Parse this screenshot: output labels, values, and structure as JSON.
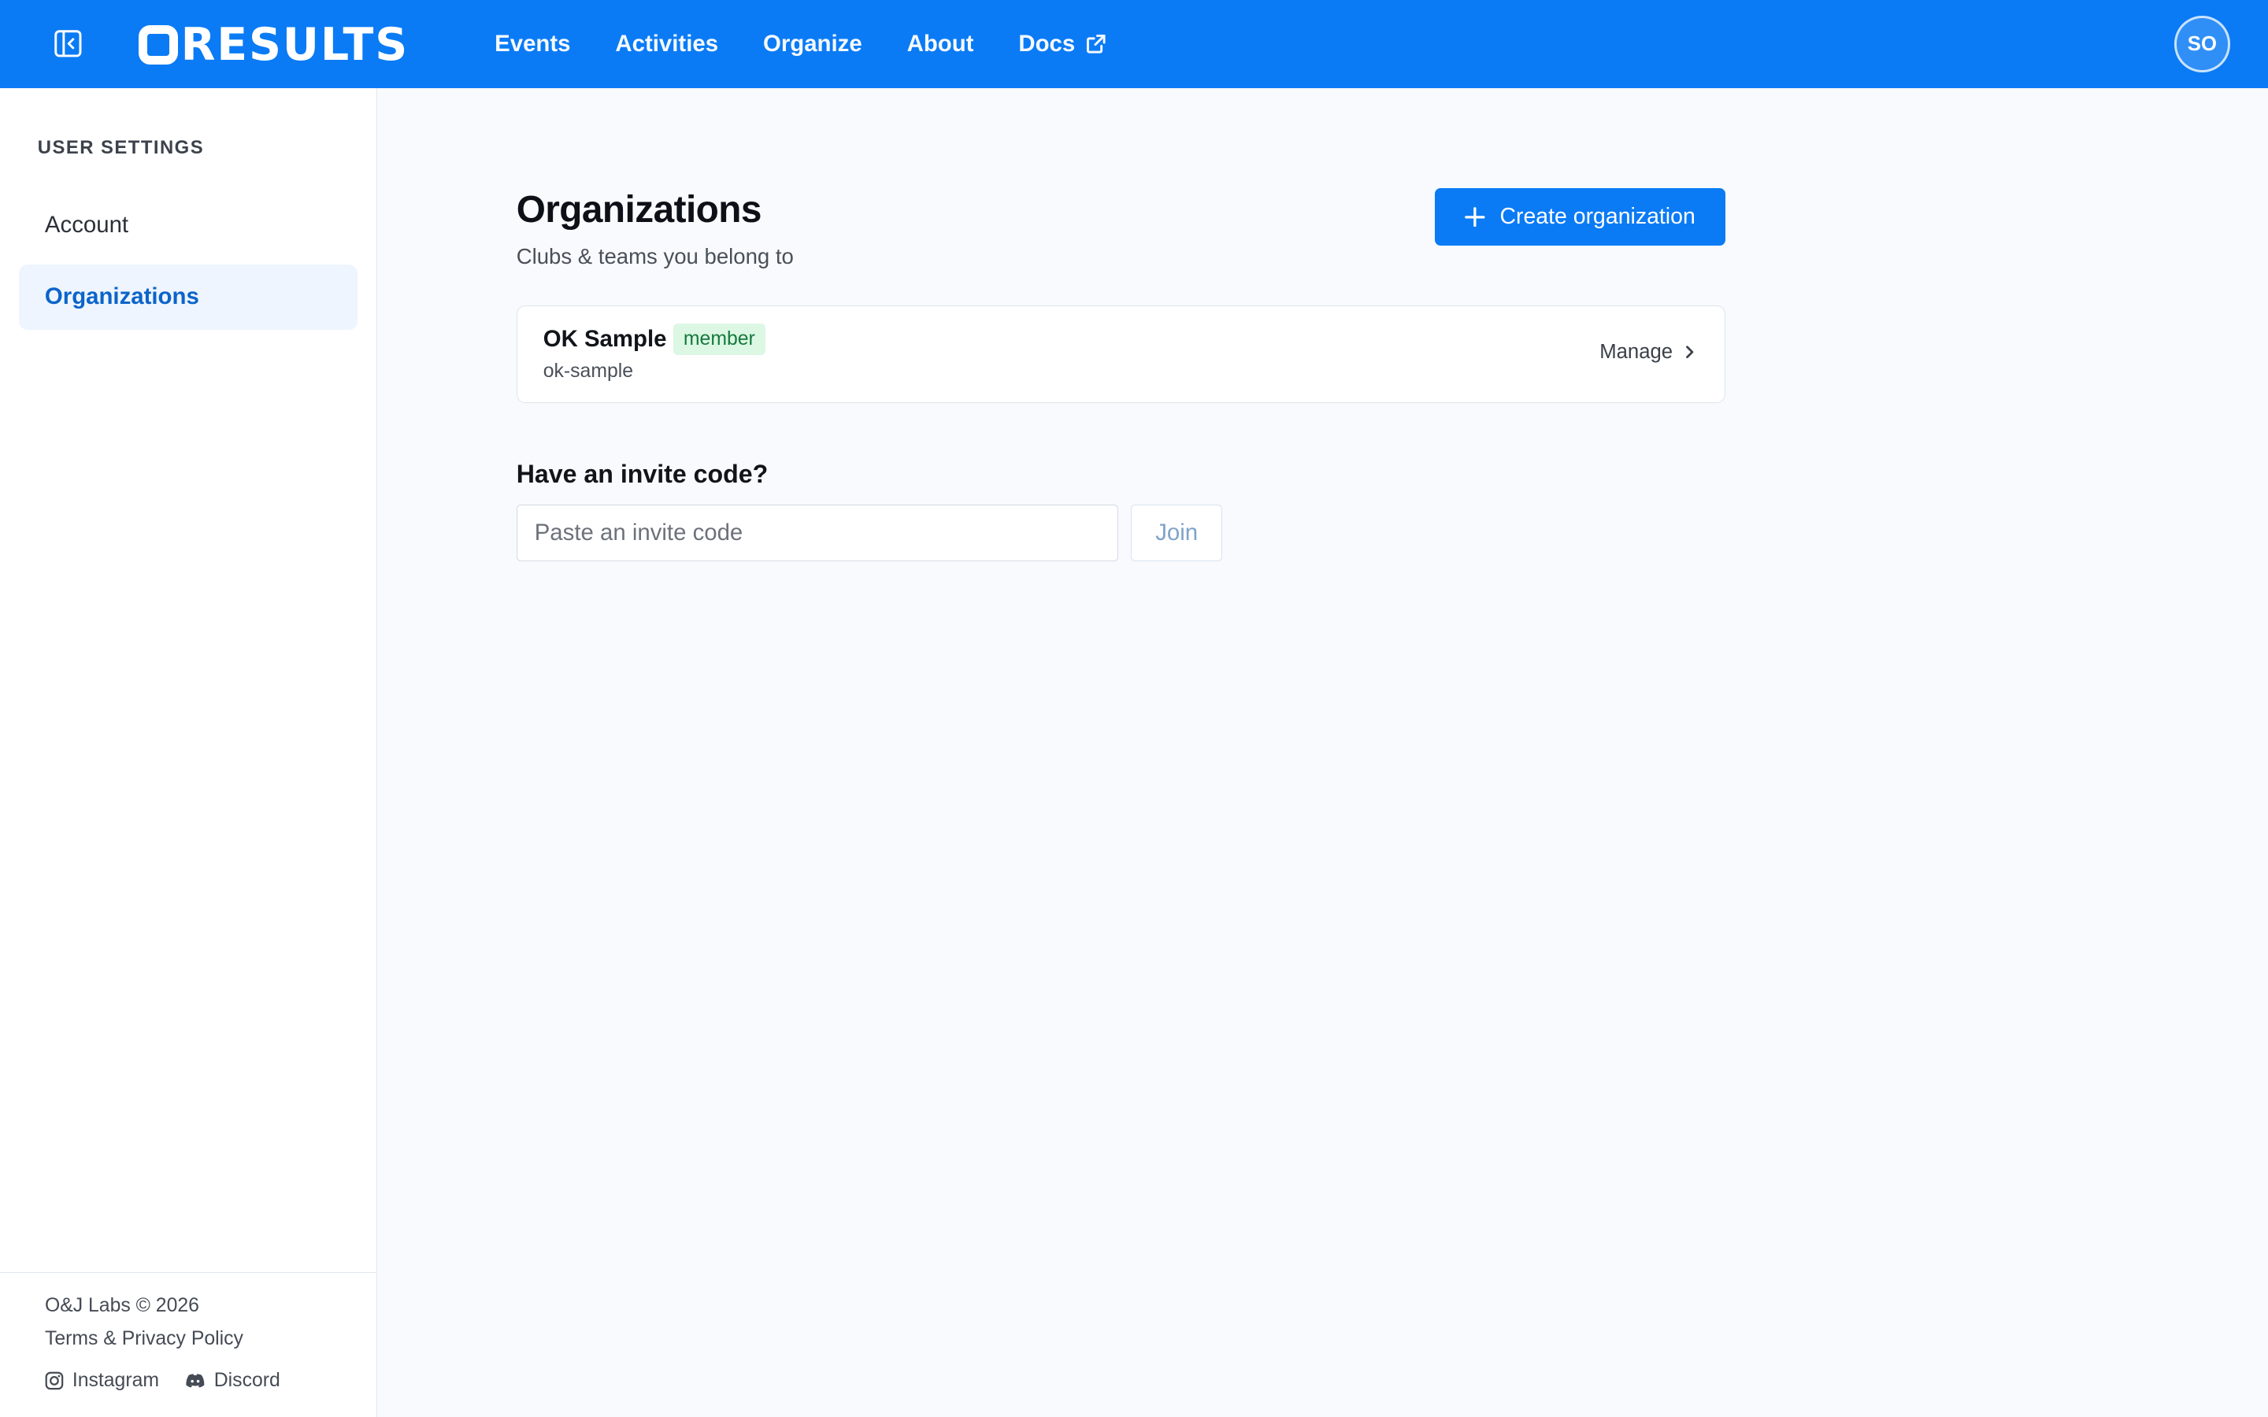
{
  "header": {
    "logo_text": "RESULTS",
    "nav": [
      {
        "label": "Events"
      },
      {
        "label": "Activities"
      },
      {
        "label": "Organize"
      },
      {
        "label": "About"
      },
      {
        "label": "Docs",
        "icon": "external-link-icon"
      }
    ],
    "avatar_initials": "SO"
  },
  "sidebar": {
    "heading": "USER SETTINGS",
    "items": [
      {
        "label": "Account",
        "active": false
      },
      {
        "label": "Organizations",
        "active": true
      }
    ],
    "footer": {
      "copyright": "O&J Labs © 2026",
      "terms": "Terms & Privacy Policy",
      "social": [
        {
          "label": "Instagram",
          "icon": "instagram-icon"
        },
        {
          "label": "Discord",
          "icon": "discord-icon"
        }
      ]
    }
  },
  "main": {
    "title": "Organizations",
    "subtitle": "Clubs & teams you belong to",
    "create_button": "Create organization",
    "organizations": [
      {
        "name": "OK Sample",
        "role": "member",
        "slug": "ok-sample",
        "action": "Manage"
      }
    ],
    "invite": {
      "heading": "Have an invite code?",
      "placeholder": "Paste an invite code",
      "value": "",
      "join_label": "Join"
    }
  },
  "colors": {
    "brand": "#0a7bf5",
    "active_nav_bg": "#eef5fe",
    "active_nav_text": "#0b64c9",
    "badge_bg": "#dcf7e4",
    "badge_text": "#157a3b"
  }
}
